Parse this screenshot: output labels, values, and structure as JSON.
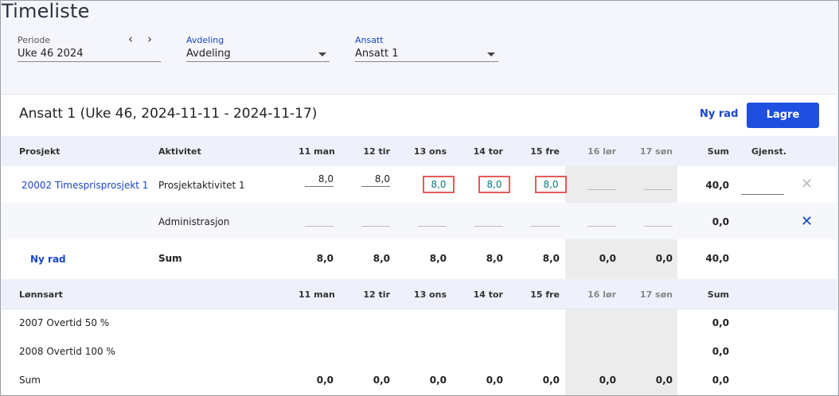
{
  "page": {
    "title": "Timeliste"
  },
  "filters": {
    "periode": {
      "label": "Periode",
      "value": "Uke 46 2024"
    },
    "avdeling": {
      "label": "Avdeling",
      "value": "Avdeling"
    },
    "ansatt": {
      "label": "Ansatt",
      "value": "Ansatt 1"
    }
  },
  "nav": {
    "prev": "‹",
    "next": "›"
  },
  "card": {
    "title": "Ansatt 1 (Uke 46, 2024-11-11 - 2024-11-17)",
    "new_row_label": "Ny rad",
    "save_label": "Lagre"
  },
  "timesheet": {
    "headers": {
      "project": "Prosjekt",
      "activity": "Aktivitet",
      "days": [
        "11 man",
        "12 tir",
        "13 ons",
        "14 tor",
        "15 fre",
        "16 lør",
        "17 søn"
      ],
      "sum": "Sum",
      "remaining": "Gjenst."
    },
    "rows": [
      {
        "project": "20002 Timesprisprosjekt 1",
        "activity": "Prosjektaktivitet 1",
        "hours": [
          "8,0",
          "8,0",
          "8,0",
          "8,0",
          "8,0",
          "",
          ""
        ],
        "sum": "40,0"
      },
      {
        "project": "",
        "activity": "Administrasjon",
        "hours": [
          "",
          "",
          "",
          "",
          "",
          "",
          ""
        ],
        "sum": "0,0"
      }
    ],
    "sum_row": {
      "new_row_label": "Ny rad",
      "label": "Sum",
      "values": [
        "8,0",
        "8,0",
        "8,0",
        "8,0",
        "8,0",
        "0,0",
        "0,0"
      ],
      "total": "40,0"
    }
  },
  "wagetypes": {
    "headers": {
      "type": "Lønnsart",
      "days": [
        "11 man",
        "12 tir",
        "13 ons",
        "14 tor",
        "15 fre",
        "16 lør",
        "17 søn"
      ],
      "sum": "Sum"
    },
    "rows": [
      {
        "name": "2007 Overtid 50 %",
        "sum": "0,0"
      },
      {
        "name": "2008 Overtid 100 %",
        "sum": "0,0"
      }
    ],
    "sum_row": {
      "label": "Sum",
      "values": [
        "0,0",
        "0,0",
        "0,0",
        "0,0",
        "0,0",
        "0,0",
        "0,0"
      ],
      "total": "0,0"
    }
  },
  "colors": {
    "accent": "#1f4fe0",
    "highlight_border": "#e35b5b",
    "weekend": "#ececec"
  },
  "icons": {
    "remove_row": "close-icon",
    "caret": "chevron-down-icon"
  }
}
